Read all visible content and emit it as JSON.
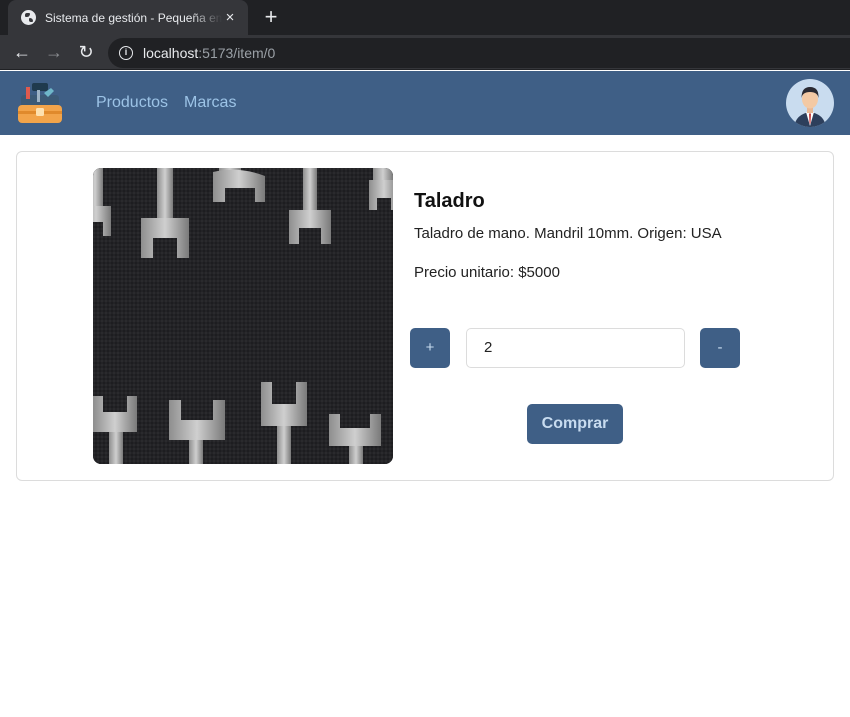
{
  "browser": {
    "tab_title": "Sistema de gestión - Pequeña empresa",
    "tab_close": "×",
    "new_tab": "+",
    "url_host": "localhost",
    "url_path": ":5173/item/0",
    "back": "←",
    "forward": "→",
    "reload": "↻",
    "info": "i"
  },
  "navbar": {
    "logo_icon": "toolbox-icon",
    "links": [
      "Productos",
      "Marcas"
    ],
    "avatar_icon": "user-avatar-icon"
  },
  "product": {
    "name": "Taladro",
    "description": "Taladro de mano. Mandril 10mm. Origen: USA",
    "price_text": "Precio unitario: $5000",
    "image_icon": "wrenches-photo"
  },
  "purchase": {
    "plus_label": "+",
    "minus_label": "-",
    "quantity": "2",
    "buy_label": "Comprar"
  },
  "colors": {
    "navbar_bg": "#3f5f86",
    "nav_link": "#9cc3e6",
    "button_bg": "#3f5f86",
    "button_text": "#c8dcf0"
  }
}
